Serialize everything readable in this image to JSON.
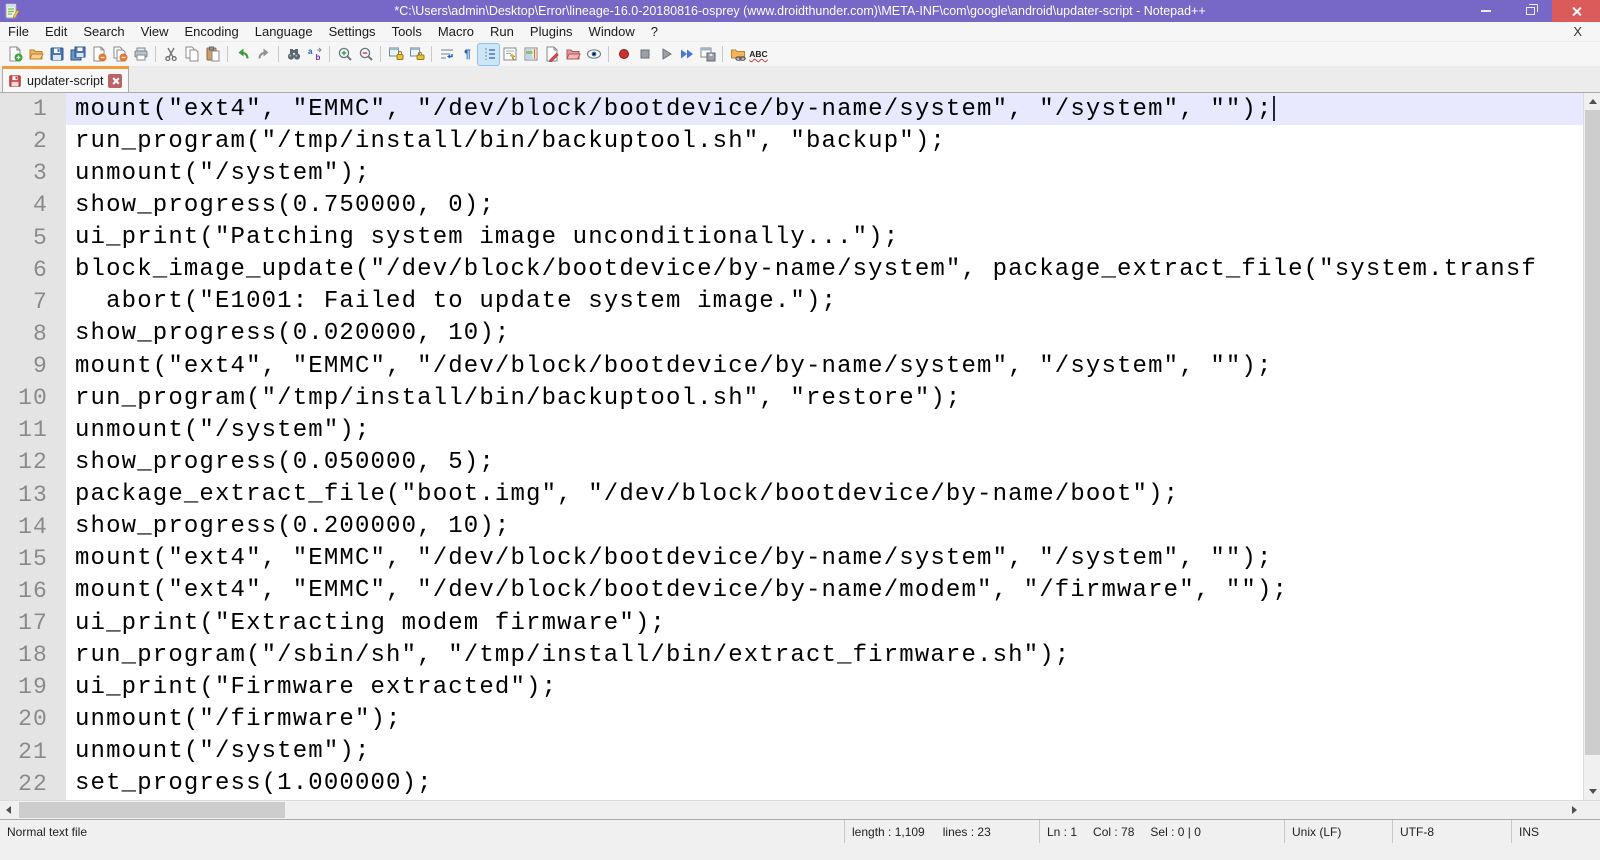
{
  "titlebar": {
    "title": "*C:\\Users\\admin\\Desktop\\Error\\lineage-16.0-20180816-osprey (www.droidthunder.com)\\META-INF\\com\\google\\android\\updater-script - Notepad++"
  },
  "menubar": {
    "items": [
      "File",
      "Edit",
      "Search",
      "View",
      "Encoding",
      "Language",
      "Settings",
      "Tools",
      "Macro",
      "Run",
      "Plugins",
      "Window",
      "?"
    ],
    "close_label": "X"
  },
  "toolbar": {
    "icons": [
      "new-file",
      "open-folder",
      "save",
      "save-all",
      "close-document",
      "close-all-documents",
      "print",
      "cut",
      "copy",
      "paste",
      "undo",
      "redo",
      "find",
      "replace",
      "zoom-in",
      "zoom-out",
      "sync-vertical-scrolling",
      "sync-horizontal-scrolling",
      "word-wrap",
      "show-all-characters",
      "show-indent-guide",
      "function-list",
      "document-map",
      "document-switcher",
      "folder-as-workspace",
      "monitoring",
      "macro-record",
      "macro-stop",
      "macro-play",
      "macro-run-multiple",
      "macro-save",
      "mime-tools",
      "spell-check"
    ],
    "pressed_icon": "show-indent-guide",
    "replace_glyph": "ab",
    "pilcrow_glyph": "¶",
    "spellcheck_glyph": "ABC"
  },
  "tabbar": {
    "tabs": [
      {
        "label": "updater-script",
        "modified": true
      }
    ]
  },
  "editor": {
    "current_line": 1,
    "lines": [
      {
        "num": "1",
        "text": "mount(\"ext4\", \"EMMC\", \"/dev/block/bootdevice/by-name/system\", \"/system\", \"\");"
      },
      {
        "num": "2",
        "text": "run_program(\"/tmp/install/bin/backuptool.sh\", \"backup\");"
      },
      {
        "num": "3",
        "text": "unmount(\"/system\");"
      },
      {
        "num": "4",
        "text": "show_progress(0.750000, 0);"
      },
      {
        "num": "5",
        "text": "ui_print(\"Patching system image unconditionally...\");"
      },
      {
        "num": "6",
        "text": "block_image_update(\"/dev/block/bootdevice/by-name/system\", package_extract_file(\"system.transf"
      },
      {
        "num": "7",
        "text": "  abort(\"E1001: Failed to update system image.\");"
      },
      {
        "num": "8",
        "text": "show_progress(0.020000, 10);"
      },
      {
        "num": "9",
        "text": "mount(\"ext4\", \"EMMC\", \"/dev/block/bootdevice/by-name/system\", \"/system\", \"\");"
      },
      {
        "num": "10",
        "text": "run_program(\"/tmp/install/bin/backuptool.sh\", \"restore\");"
      },
      {
        "num": "11",
        "text": "unmount(\"/system\");"
      },
      {
        "num": "12",
        "text": "show_progress(0.050000, 5);"
      },
      {
        "num": "13",
        "text": "package_extract_file(\"boot.img\", \"/dev/block/bootdevice/by-name/boot\");"
      },
      {
        "num": "14",
        "text": "show_progress(0.200000, 10);"
      },
      {
        "num": "15",
        "text": "mount(\"ext4\", \"EMMC\", \"/dev/block/bootdevice/by-name/system\", \"/system\", \"\");"
      },
      {
        "num": "16",
        "text": "mount(\"ext4\", \"EMMC\", \"/dev/block/bootdevice/by-name/modem\", \"/firmware\", \"\");"
      },
      {
        "num": "17",
        "text": "ui_print(\"Extracting modem firmware\");"
      },
      {
        "num": "18",
        "text": "run_program(\"/sbin/sh\", \"/tmp/install/bin/extract_firmware.sh\");"
      },
      {
        "num": "19",
        "text": "ui_print(\"Firmware extracted\");"
      },
      {
        "num": "20",
        "text": "unmount(\"/firmware\");"
      },
      {
        "num": "21",
        "text": "unmount(\"/system\");"
      },
      {
        "num": "22",
        "text": "set_progress(1.000000);"
      }
    ]
  },
  "statusbar": {
    "doc_type": "Normal text file",
    "length": "length : 1,109",
    "lines": "lines : 23",
    "ln": "Ln : 1",
    "col": "Col : 78",
    "sel": "Sel : 0 | 0",
    "eol": "Unix (LF)",
    "encoding": "UTF-8",
    "insert_mode": "INS"
  },
  "colors": {
    "titlebar_bg": "#7767C6",
    "close_button_bg": "#DB5B5B",
    "active_tab_top": "#F79A38",
    "current_line_bg": "#E8E8FF",
    "gutter_bg": "#E4E4E4"
  }
}
